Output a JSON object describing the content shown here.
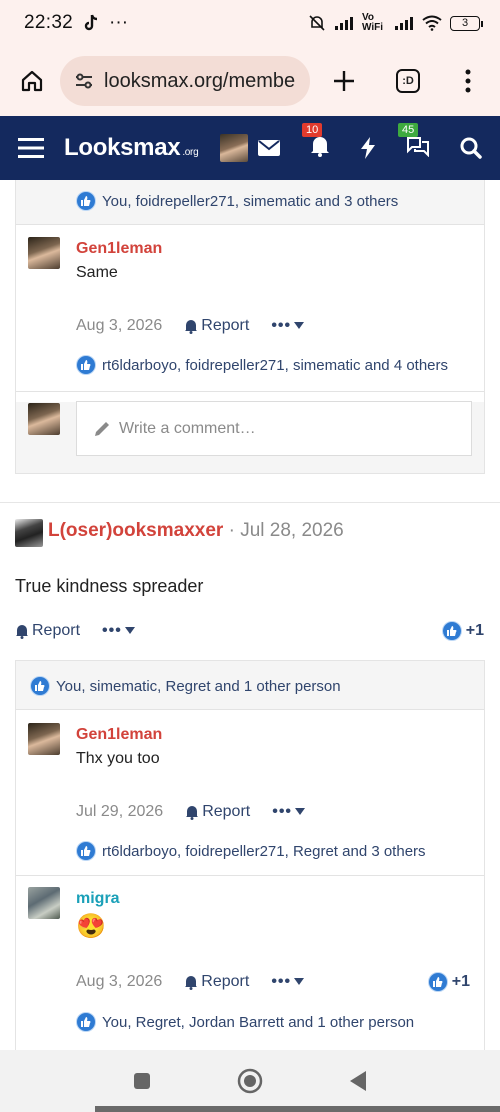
{
  "status_bar": {
    "time": "22:32",
    "dots": "···",
    "network": "Vo WiFi",
    "battery": "3"
  },
  "browser": {
    "url": "looksmax.org/membe",
    "tab_count": ":D"
  },
  "site": {
    "logo_main": "Looksmax",
    "logo_org": ".org",
    "notifications_count": "10",
    "conversations_count": "45"
  },
  "block1": {
    "top_reactions": "You, foidrepeller271, simematic and 3 others",
    "comment": {
      "author": "Gen1leman",
      "text": "Same",
      "date": "Aug 3, 2026",
      "report": "Report",
      "reactions": "rt6ldarboyo, foidrepeller271, simematic and 4 others"
    },
    "write_placeholder": "Write a comment…"
  },
  "post": {
    "author": "L(oser)ooksmaxxer",
    "sep": " · ",
    "date": "Jul 28, 2026",
    "body": "True kindness spreader",
    "report": "Report",
    "plus": "+1"
  },
  "block2": {
    "top_reactions": "You, simematic, Regret and 1 other person",
    "comment1": {
      "author": "Gen1leman",
      "text": "Thx you too",
      "date": "Jul 29, 2026",
      "report": "Report",
      "reactions": "rt6ldarboyo, foidrepeller271, Regret and 3 others"
    },
    "comment2": {
      "author": "migra",
      "emoji": "😍",
      "date": "Aug 3, 2026",
      "report": "Report",
      "plus": "+1",
      "reactions": "You, Regret, Jordan Barrett and 1 other person"
    }
  },
  "colors": {
    "header": "#14295e",
    "name_red": "#d2433b",
    "name_teal": "#1aa0b8",
    "link": "#30456d"
  }
}
